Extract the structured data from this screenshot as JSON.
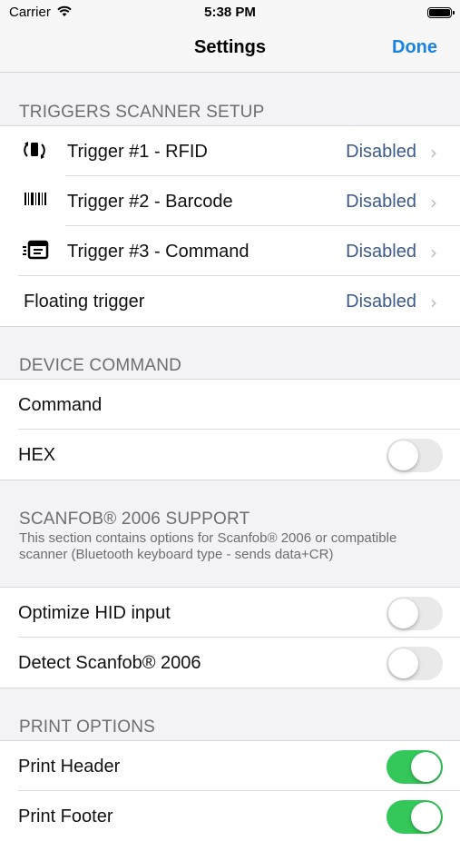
{
  "status_bar": {
    "carrier": "Carrier",
    "time": "5:38 PM"
  },
  "nav": {
    "title": "Settings",
    "done_label": "Done"
  },
  "colors": {
    "accent": "#1a82e0",
    "value_text": "#3c5a8a",
    "switch_on": "#34c759"
  },
  "sections": {
    "triggers": {
      "header": "TRIGGERS SCANNER SETUP",
      "rows": [
        {
          "icon": "rfid-icon",
          "label": "Trigger #1 - RFID",
          "value": "Disabled"
        },
        {
          "icon": "barcode-icon",
          "label": "Trigger #2 - Barcode",
          "value": "Disabled"
        },
        {
          "icon": "command-icon",
          "label": "Trigger #3 - Command",
          "value": "Disabled"
        },
        {
          "label": "Floating trigger",
          "value": "Disabled"
        }
      ]
    },
    "device_command": {
      "header": "DEVICE COMMAND",
      "command_label": "Command",
      "hex_label": "HEX",
      "hex_on": false
    },
    "scanfob": {
      "header": "SCANFOB® 2006 SUPPORT",
      "description": "This section contains options for Scanfob® 2006 or compatible scanner (Bluetooth keyboard type - sends data+CR)",
      "optimize_label": "Optimize HID input",
      "optimize_on": false,
      "detect_label": "Detect Scanfob® 2006",
      "detect_on": false
    },
    "print": {
      "header": "PRINT OPTIONS",
      "header_label": "Print Header",
      "header_on": true,
      "footer_label": "Print Footer",
      "footer_on": true
    }
  }
}
